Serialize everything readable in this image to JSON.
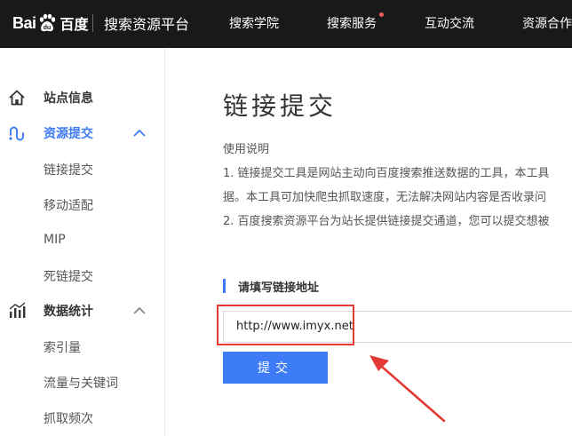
{
  "header": {
    "logo_left": "Bai",
    "logo_mid": "du",
    "logo_cn": "百度",
    "platform_name": "搜索资源平台",
    "nav": [
      {
        "label": "搜索学院"
      },
      {
        "label": "搜索服务",
        "has_dot": true
      },
      {
        "label": "互动交流"
      },
      {
        "label": "资源合作"
      }
    ]
  },
  "sidebar": {
    "sections": [
      {
        "label": "站点信息",
        "icon": "home-icon",
        "active": false
      },
      {
        "label": "资源提交",
        "icon": "link-icon",
        "active": true,
        "expanded": true,
        "items": [
          "链接提交",
          "移动适配",
          "MIP",
          "死链提交"
        ]
      },
      {
        "label": "数据统计",
        "icon": "bar-chart-icon",
        "active": false,
        "expanded": true,
        "items": [
          "索引量",
          "流量与关键词",
          "抓取频次"
        ]
      }
    ]
  },
  "main": {
    "title": "链接提交",
    "usage_title": "使用说明",
    "desc_lines": [
      "1. 链接提交工具是网站主动向百度搜索推送数据的工具，本工具",
      "据。本工具可加快爬虫抓取速度，无法解决网站内容是否收录问",
      "2. 百度搜索资源平台为站长提供链接提交通道，您可以提交想被"
    ],
    "section_title": "请填写链接地址",
    "url_value": "http://www.imyx.net",
    "submit_label": "提交"
  },
  "colors": {
    "topbar_bg": "#191919",
    "accent": "#3e7bf7",
    "annotation_red": "#e53935",
    "nav_dot": "#f25a5a"
  }
}
